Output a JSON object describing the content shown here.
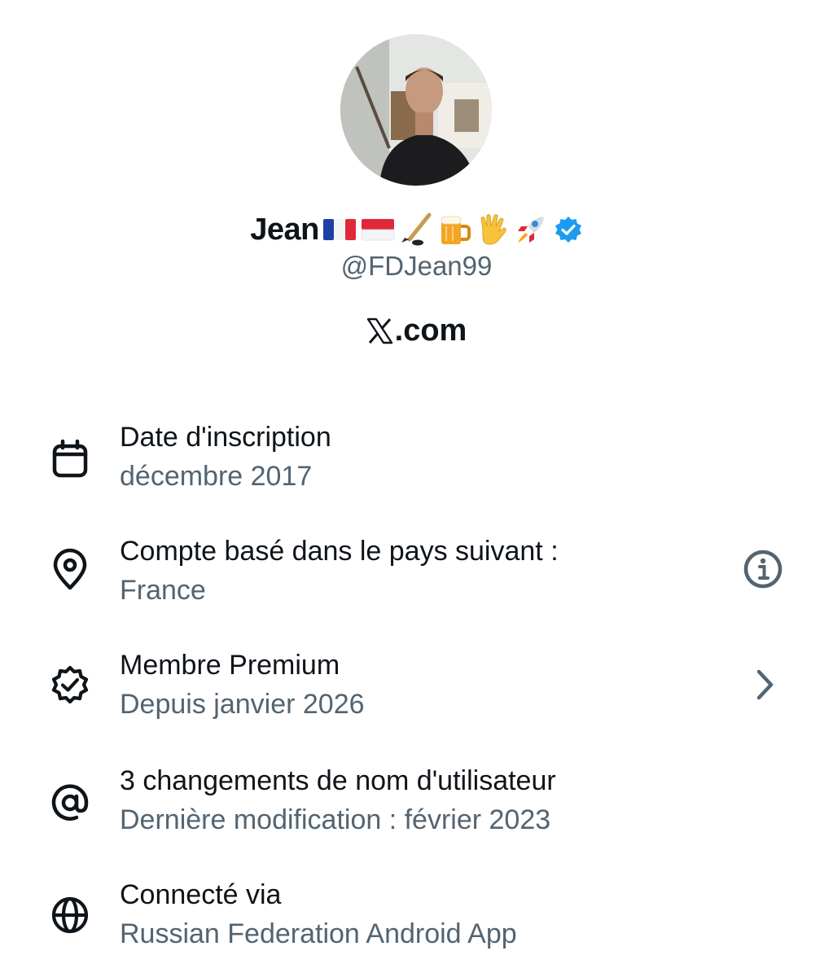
{
  "profile": {
    "display_name": "Jean",
    "name_emojis": [
      "flag-france",
      "flag-monaco",
      "hockey-stick",
      "beer-mug",
      "vulcan-salute",
      "rocket"
    ],
    "verified": true,
    "handle": "@FDJean99",
    "site_text": ".com"
  },
  "details": [
    {
      "title": "Date d'inscription",
      "subtitle": "décembre 2017",
      "icon": "calendar-icon"
    },
    {
      "title": "Compte basé dans le pays suivant :",
      "subtitle": "France",
      "icon": "location-pin-icon",
      "right_icon": "info-icon"
    },
    {
      "title": "Membre Premium",
      "subtitle": "Depuis janvier 2026",
      "icon": "verified-badge-outline-icon",
      "right_icon": "chevron-right-icon"
    },
    {
      "title": "3 changements de nom d'utilisateur",
      "subtitle": "Dernière modification : février 2023",
      "icon": "at-sign-icon"
    },
    {
      "title": "Connecté via",
      "subtitle": "Russian Federation Android App",
      "icon": "globe-icon"
    }
  ],
  "colors": {
    "primary_text": "#0f1419",
    "secondary_text": "#536471",
    "verified_blue": "#1d9bf0"
  }
}
